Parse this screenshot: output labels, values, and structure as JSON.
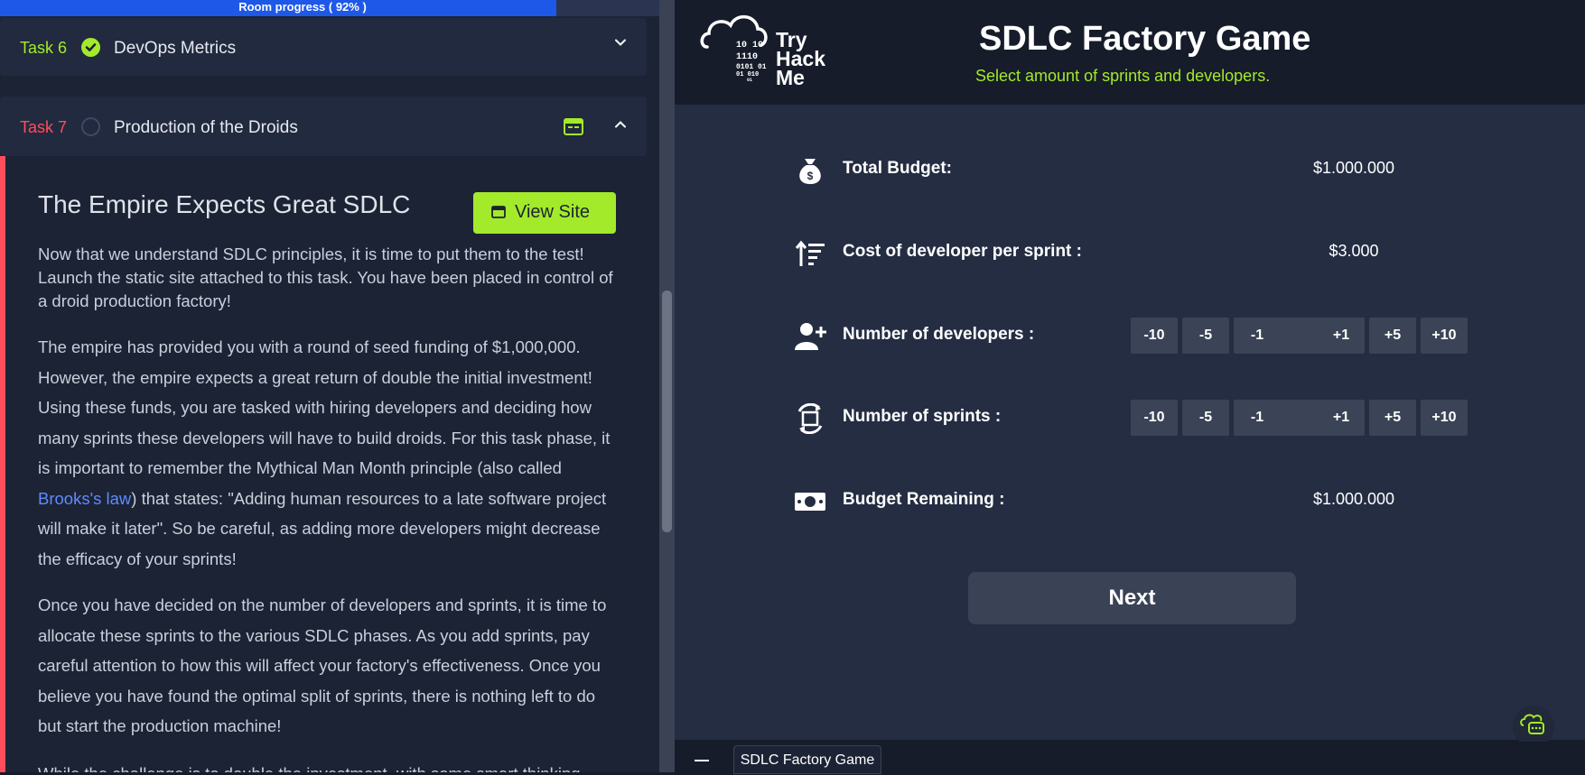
{
  "progress": {
    "label": "Room progress ( 92% )",
    "percent": 92
  },
  "tasks": [
    {
      "number": "Task 6",
      "title": "DevOps Metrics",
      "status": "complete"
    },
    {
      "number": "Task 7",
      "title": "Production of the Droids",
      "status": "open"
    }
  ],
  "task_body": {
    "title": "The Empire Expects Great SDLC",
    "view_site_label": "View Site",
    "p1": "Now that we understand SDLC principles, it is time to put them to the test! Launch the static site attached to this task. You have been placed in control of a droid production factory!",
    "p2_before": "The empire has provided you with a round of seed funding of $1,000,000. However, the empire expects a great return of double the initial investment! Using these funds, you are tasked with hiring developers and deciding how many sprints these developers will have to build droids. For this task phase, it is important to remember the Mythical Man Month principle (also called ",
    "p2_link": "Brooks's law",
    "p2_after": ") that states: \"Adding human resources to a late software project will make it later\". So be careful, as adding more developers might decrease the efficacy of your sprints!",
    "p3": "Once you have decided on the number of developers and sprints, it is time to allocate these sprints to the various SDLC phases. As you add sprints, pay careful attention to how this will affect your factory's effectiveness. Once you believe you have found the optimal split of sprints, there is nothing left to do but start the production machine!",
    "p4": "While the challenge is to double the investment, with some smart thinking"
  },
  "game": {
    "logo_text": [
      "Try",
      "Hack",
      "Me"
    ],
    "logo_bits": [
      "10 10",
      "1110",
      "0101 01",
      "01 010",
      "01"
    ],
    "title": "SDLC Factory Game",
    "subtitle": "Select amount of sprints and developers.",
    "rows": [
      {
        "icon": "money-bag-icon",
        "label": "Total Budget:",
        "value": "$1.000.000"
      },
      {
        "icon": "sort-up-icon",
        "label": "Cost of developer per sprint :",
        "value": "$3.000"
      },
      {
        "icon": "user-plus-icon",
        "label": "Number of developers :",
        "buttons": [
          "-10",
          "-5",
          "-1",
          "+1",
          "+5",
          "+10"
        ]
      },
      {
        "icon": "sync-icon",
        "label": "Number of sprints :",
        "buttons": [
          "-10",
          "-5",
          "-1",
          "+1",
          "+5",
          "+10"
        ]
      },
      {
        "icon": "banknote-icon",
        "label": "Budget Remaining :",
        "value": "$1.000.000"
      }
    ],
    "next_label": "Next"
  },
  "bottom": {
    "tab_label": "SDLC Factory Game"
  },
  "colors": {
    "accent": "#a3ea2a",
    "danger": "#ff4d5e",
    "link": "#5e8bff",
    "progress": "#1e58e8"
  }
}
